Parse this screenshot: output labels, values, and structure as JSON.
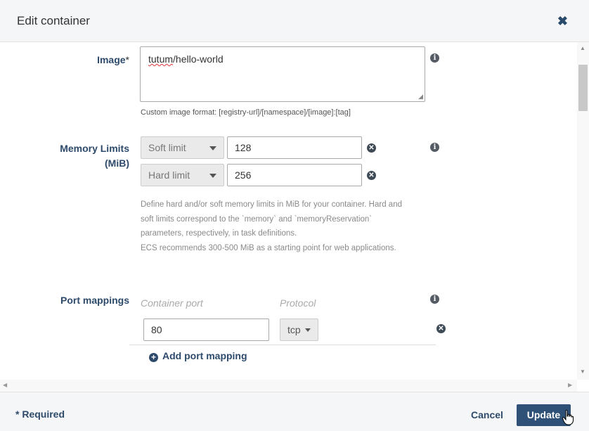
{
  "modal": {
    "title": "Edit container",
    "close_glyph": "✖"
  },
  "image": {
    "label": "Image",
    "required_mark": "*",
    "value_underlined": "tutum",
    "value_rest": "/hello-world",
    "help": "Custom image format: [registry-url]/[namespace]/[image]:[tag]"
  },
  "memory": {
    "label_line1": "Memory Limits",
    "label_line2": "(MiB)",
    "soft": {
      "select_label": "Soft limit",
      "value": "128"
    },
    "hard": {
      "select_label": "Hard limit",
      "value": "256"
    },
    "help_lines": [
      "Define hard and/or soft memory limits in MiB for your container. Hard and",
      "soft limits correspond to the `memory` and `memoryReservation`",
      "parameters, respectively, in task definitions.",
      "ECS recommends 300-500 MiB as a starting point for web applications."
    ]
  },
  "ports": {
    "label": "Port mappings",
    "col_container_port": "Container port",
    "col_protocol": "Protocol",
    "rows": [
      {
        "container_port": "80",
        "protocol": "tcp"
      }
    ],
    "add_label": "Add port mapping"
  },
  "footer": {
    "required_note": "* Required",
    "cancel_label": "Cancel",
    "update_label": "Update"
  },
  "icons": {
    "info": "info-icon",
    "clear": "clear-circle-icon",
    "add": "plus-circle-icon"
  },
  "colors": {
    "accent": "#2f5177",
    "label": "#2d4a6b",
    "header_bg": "#f5f6f7"
  }
}
